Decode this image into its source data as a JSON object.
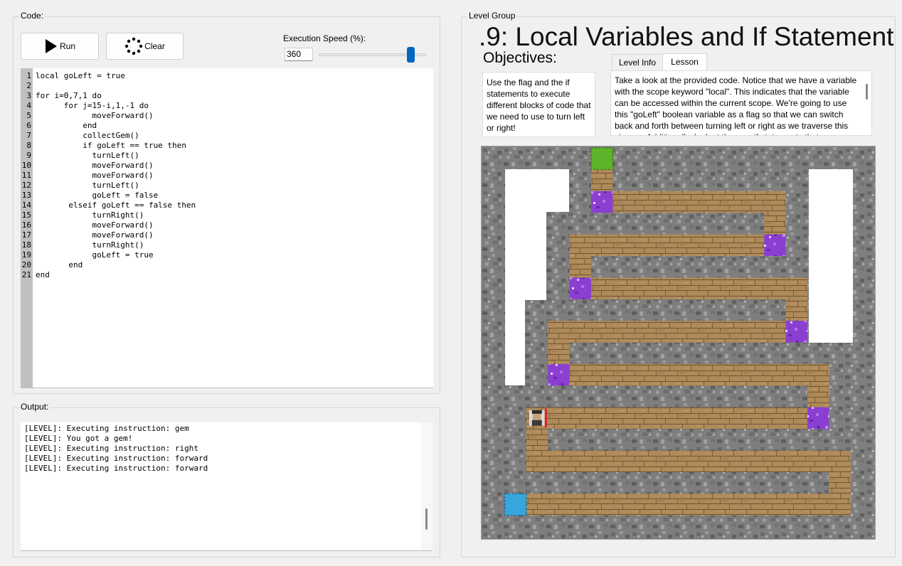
{
  "code_panel": {
    "title": "Code:",
    "run_label": "Run",
    "clear_label": "Clear",
    "speed_label": "Execution Speed (%):",
    "speed_value": "360",
    "speed_fraction": 0.92,
    "lines": [
      "local goLeft = true",
      "",
      "for i=0,7,1 do",
      "      for j=15-i,1,-1 do",
      "            moveForward()",
      "          end",
      "          collectGem()",
      "          if goLeft == true then",
      "            turnLeft()",
      "            moveForward()",
      "            moveForward()",
      "            turnLeft()",
      "            goLeft = false",
      "       elseif goLeft == false then",
      "            turnRight()",
      "            moveForward()",
      "            moveForward()",
      "            turnRight()",
      "            goLeft = true",
      "       end",
      "end"
    ]
  },
  "output_panel": {
    "title": "Output:",
    "lines": [
      "[LEVEL]: Executing instruction: gem",
      "[LEVEL]: You got a gem!",
      "[LEVEL]: Executing instruction: right",
      "[LEVEL]: Executing instruction: forward",
      "[LEVEL]: Executing instruction: forward"
    ]
  },
  "level_panel": {
    "group_title": "Level Group",
    "title": ".9: Local Variables and If Statement",
    "objectives_heading": "Objectives:",
    "objective_text": "Use the flag and the if statements to execute different blocks of code that we need to use to turn left or right!",
    "tabs": [
      "Level Info",
      "Lesson"
    ],
    "active_tab": "Lesson",
    "lesson_text": "Take a look at the provided code. Notice that we have a variable with the scope keyword \"local\". This indicates that the variable can be accessed within the current scope. We're going to use this \"goLeft\" boolean variable as a flag so that we can switch back and forth between turning left or right as we traverse this zig-zag. Additionally, look at the new if statements that"
  },
  "colors": {
    "accent": "#0067c0",
    "stone": "#7d7d7d",
    "plank": "#b0895a",
    "gem": "#9b4ad6",
    "start": "#36a6dc",
    "goal": "#5fb32a"
  },
  "board": {
    "legend": [
      "stone-wall",
      "wood-path",
      "purple-gem",
      "blue-start-tile",
      "green-goal-tile",
      "player"
    ]
  }
}
